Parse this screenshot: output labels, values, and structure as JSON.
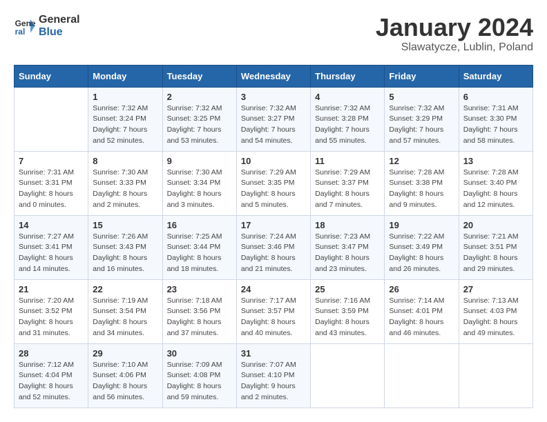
{
  "header": {
    "logo_line1": "General",
    "logo_line2": "Blue",
    "month_title": "January 2024",
    "subtitle": "Slawatycze, Lublin, Poland"
  },
  "weekdays": [
    "Sunday",
    "Monday",
    "Tuesday",
    "Wednesday",
    "Thursday",
    "Friday",
    "Saturday"
  ],
  "weeks": [
    [
      {
        "day": "",
        "info": ""
      },
      {
        "day": "1",
        "info": "Sunrise: 7:32 AM\nSunset: 3:24 PM\nDaylight: 7 hours\nand 52 minutes."
      },
      {
        "day": "2",
        "info": "Sunrise: 7:32 AM\nSunset: 3:25 PM\nDaylight: 7 hours\nand 53 minutes."
      },
      {
        "day": "3",
        "info": "Sunrise: 7:32 AM\nSunset: 3:27 PM\nDaylight: 7 hours\nand 54 minutes."
      },
      {
        "day": "4",
        "info": "Sunrise: 7:32 AM\nSunset: 3:28 PM\nDaylight: 7 hours\nand 55 minutes."
      },
      {
        "day": "5",
        "info": "Sunrise: 7:32 AM\nSunset: 3:29 PM\nDaylight: 7 hours\nand 57 minutes."
      },
      {
        "day": "6",
        "info": "Sunrise: 7:31 AM\nSunset: 3:30 PM\nDaylight: 7 hours\nand 58 minutes."
      }
    ],
    [
      {
        "day": "7",
        "info": "Sunrise: 7:31 AM\nSunset: 3:31 PM\nDaylight: 8 hours\nand 0 minutes."
      },
      {
        "day": "8",
        "info": "Sunrise: 7:30 AM\nSunset: 3:33 PM\nDaylight: 8 hours\nand 2 minutes."
      },
      {
        "day": "9",
        "info": "Sunrise: 7:30 AM\nSunset: 3:34 PM\nDaylight: 8 hours\nand 3 minutes."
      },
      {
        "day": "10",
        "info": "Sunrise: 7:29 AM\nSunset: 3:35 PM\nDaylight: 8 hours\nand 5 minutes."
      },
      {
        "day": "11",
        "info": "Sunrise: 7:29 AM\nSunset: 3:37 PM\nDaylight: 8 hours\nand 7 minutes."
      },
      {
        "day": "12",
        "info": "Sunrise: 7:28 AM\nSunset: 3:38 PM\nDaylight: 8 hours\nand 9 minutes."
      },
      {
        "day": "13",
        "info": "Sunrise: 7:28 AM\nSunset: 3:40 PM\nDaylight: 8 hours\nand 12 minutes."
      }
    ],
    [
      {
        "day": "14",
        "info": "Sunrise: 7:27 AM\nSunset: 3:41 PM\nDaylight: 8 hours\nand 14 minutes."
      },
      {
        "day": "15",
        "info": "Sunrise: 7:26 AM\nSunset: 3:43 PM\nDaylight: 8 hours\nand 16 minutes."
      },
      {
        "day": "16",
        "info": "Sunrise: 7:25 AM\nSunset: 3:44 PM\nDaylight: 8 hours\nand 18 minutes."
      },
      {
        "day": "17",
        "info": "Sunrise: 7:24 AM\nSunset: 3:46 PM\nDaylight: 8 hours\nand 21 minutes."
      },
      {
        "day": "18",
        "info": "Sunrise: 7:23 AM\nSunset: 3:47 PM\nDaylight: 8 hours\nand 23 minutes."
      },
      {
        "day": "19",
        "info": "Sunrise: 7:22 AM\nSunset: 3:49 PM\nDaylight: 8 hours\nand 26 minutes."
      },
      {
        "day": "20",
        "info": "Sunrise: 7:21 AM\nSunset: 3:51 PM\nDaylight: 8 hours\nand 29 minutes."
      }
    ],
    [
      {
        "day": "21",
        "info": "Sunrise: 7:20 AM\nSunset: 3:52 PM\nDaylight: 8 hours\nand 31 minutes."
      },
      {
        "day": "22",
        "info": "Sunrise: 7:19 AM\nSunset: 3:54 PM\nDaylight: 8 hours\nand 34 minutes."
      },
      {
        "day": "23",
        "info": "Sunrise: 7:18 AM\nSunset: 3:56 PM\nDaylight: 8 hours\nand 37 minutes."
      },
      {
        "day": "24",
        "info": "Sunrise: 7:17 AM\nSunset: 3:57 PM\nDaylight: 8 hours\nand 40 minutes."
      },
      {
        "day": "25",
        "info": "Sunrise: 7:16 AM\nSunset: 3:59 PM\nDaylight: 8 hours\nand 43 minutes."
      },
      {
        "day": "26",
        "info": "Sunrise: 7:14 AM\nSunset: 4:01 PM\nDaylight: 8 hours\nand 46 minutes."
      },
      {
        "day": "27",
        "info": "Sunrise: 7:13 AM\nSunset: 4:03 PM\nDaylight: 8 hours\nand 49 minutes."
      }
    ],
    [
      {
        "day": "28",
        "info": "Sunrise: 7:12 AM\nSunset: 4:04 PM\nDaylight: 8 hours\nand 52 minutes."
      },
      {
        "day": "29",
        "info": "Sunrise: 7:10 AM\nSunset: 4:06 PM\nDaylight: 8 hours\nand 56 minutes."
      },
      {
        "day": "30",
        "info": "Sunrise: 7:09 AM\nSunset: 4:08 PM\nDaylight: 8 hours\nand 59 minutes."
      },
      {
        "day": "31",
        "info": "Sunrise: 7:07 AM\nSunset: 4:10 PM\nDaylight: 9 hours\nand 2 minutes."
      },
      {
        "day": "",
        "info": ""
      },
      {
        "day": "",
        "info": ""
      },
      {
        "day": "",
        "info": ""
      }
    ]
  ]
}
